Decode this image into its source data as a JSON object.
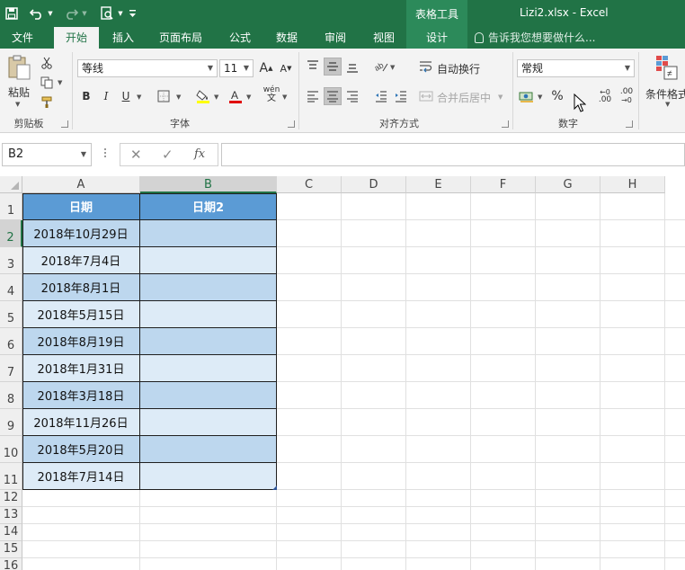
{
  "app": {
    "context_title": "表格工具",
    "document_title": "Lizi2.xlsx - Excel"
  },
  "tabs": [
    {
      "label": "文件"
    },
    {
      "label": "开始"
    },
    {
      "label": "插入"
    },
    {
      "label": "页面布局"
    },
    {
      "label": "公式"
    },
    {
      "label": "数据"
    },
    {
      "label": "审阅"
    },
    {
      "label": "视图"
    },
    {
      "label": "设计"
    }
  ],
  "tell_me": "告诉我您想要做什么...",
  "ribbon": {
    "clipboard": {
      "label": "剪贴板",
      "paste_label": "粘贴"
    },
    "font": {
      "label": "字体",
      "font_name": "等线",
      "font_size": "11",
      "bold": "B",
      "italic": "I",
      "underline": "U",
      "grow": "A",
      "shrink": "A",
      "phonetic": "wén"
    },
    "alignment": {
      "label": "对齐方式",
      "wrap_text": "自动换行",
      "merge_center": "合并后居中"
    },
    "number": {
      "label": "数字",
      "format": "常规",
      "percent": "%",
      "comma": ",",
      "increase_decimal": ".00",
      "decrease_decimal": ".00"
    },
    "styles": {
      "conditional_format": "条件格式"
    }
  },
  "formula_bar": {
    "name_box": "B2",
    "formula": "",
    "fx": "fx"
  },
  "sheet": {
    "columns": [
      "A",
      "B",
      "C",
      "D",
      "E",
      "F",
      "G",
      "H"
    ],
    "rows": [
      "1",
      "2",
      "3",
      "4",
      "5",
      "6",
      "7",
      "8",
      "9",
      "10",
      "11",
      "12",
      "13",
      "14",
      "15",
      "16"
    ],
    "selected_cell": "B2",
    "table": {
      "headers": [
        "日期",
        "日期2"
      ],
      "rows": [
        [
          "2018年10月29日",
          ""
        ],
        [
          "2018年7月4日",
          ""
        ],
        [
          "2018年8月1日",
          ""
        ],
        [
          "2018年5月15日",
          ""
        ],
        [
          "2018年8月19日",
          ""
        ],
        [
          "2018年1月31日",
          ""
        ],
        [
          "2018年3月18日",
          ""
        ],
        [
          "2018年11月26日",
          ""
        ],
        [
          "2018年5月20日",
          ""
        ],
        [
          "2018年7月14日",
          ""
        ]
      ]
    }
  },
  "colors": {
    "brand": "#217346",
    "table_header": "#5b9bd5",
    "band_dark": "#bdd7ee",
    "band_light": "#ddebf7"
  }
}
